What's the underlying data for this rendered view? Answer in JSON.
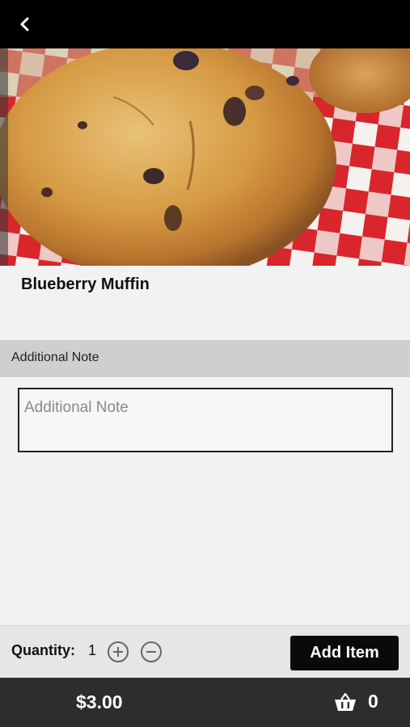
{
  "header": {
    "back_icon": "chevron-left-icon"
  },
  "product": {
    "image": "blueberry-muffin-photo",
    "name": "Blueberry Muffin"
  },
  "note": {
    "section_label": "Additional Note",
    "placeholder": "Additional Note",
    "value": ""
  },
  "order": {
    "quantity_label": "Quantity:",
    "quantity": "1",
    "increment_icon": "plus-circle-icon",
    "decrement_icon": "minus-circle-icon",
    "add_button_label": "Add Item"
  },
  "footer": {
    "price": "$3.00",
    "cart_icon": "basket-icon",
    "cart_count": "0"
  },
  "colors": {
    "top_bar": "#000000",
    "footer_bar": "#2d2d2d",
    "button": "#0a0a0a",
    "section_header": "#cfcfcf"
  }
}
